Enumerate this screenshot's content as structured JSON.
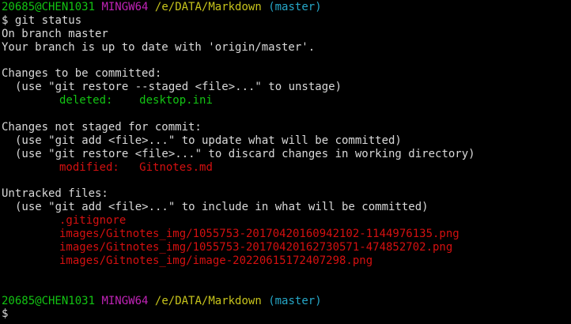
{
  "theme": {
    "background": "#000000",
    "foreground": "#d9d9d9",
    "green": "#13c413",
    "red": "#d51010",
    "magenta": "#c023b7",
    "yellow": "#c7c41c",
    "cyan": "#26a7c8"
  },
  "prompt1": {
    "user_host": "20685@CHEN1031",
    "env": "MINGW64",
    "path": "/e/DATA/Markdown",
    "branch": "(master)"
  },
  "command": {
    "symbol": "$",
    "text": "git status"
  },
  "output": {
    "on_branch": "On branch master",
    "up_to_date": "Your branch is up to date with 'origin/master'.",
    "staged_header": "Changes to be committed:",
    "staged_hint": "(use \"git restore --staged <file>...\" to unstage)",
    "staged_files": [
      {
        "status": "deleted:",
        "file": "desktop.ini"
      }
    ],
    "unstaged_header": "Changes not staged for commit:",
    "unstaged_hints": [
      "(use \"git add <file>...\" to update what will be committed)",
      "(use \"git restore <file>...\" to discard changes in working directory)"
    ],
    "unstaged_files": [
      {
        "status": "modified:",
        "file": "Gitnotes.md"
      }
    ],
    "untracked_header": "Untracked files:",
    "untracked_hint": "(use \"git add <file>...\" to include in what will be committed)",
    "untracked_files": [
      ".gitignore",
      "images/Gitnotes_img/1055753-20170420160942102-1144976135.png",
      "images/Gitnotes_img/1055753-20170420162730571-474852702.png",
      "images/Gitnotes_img/image-20220615172407298.png"
    ]
  },
  "prompt2": {
    "user_host": "20685@CHEN1031",
    "env": "MINGW64",
    "path": "/e/DATA/Markdown",
    "branch": "(master)"
  },
  "input": {
    "symbol": "$",
    "value": ""
  }
}
